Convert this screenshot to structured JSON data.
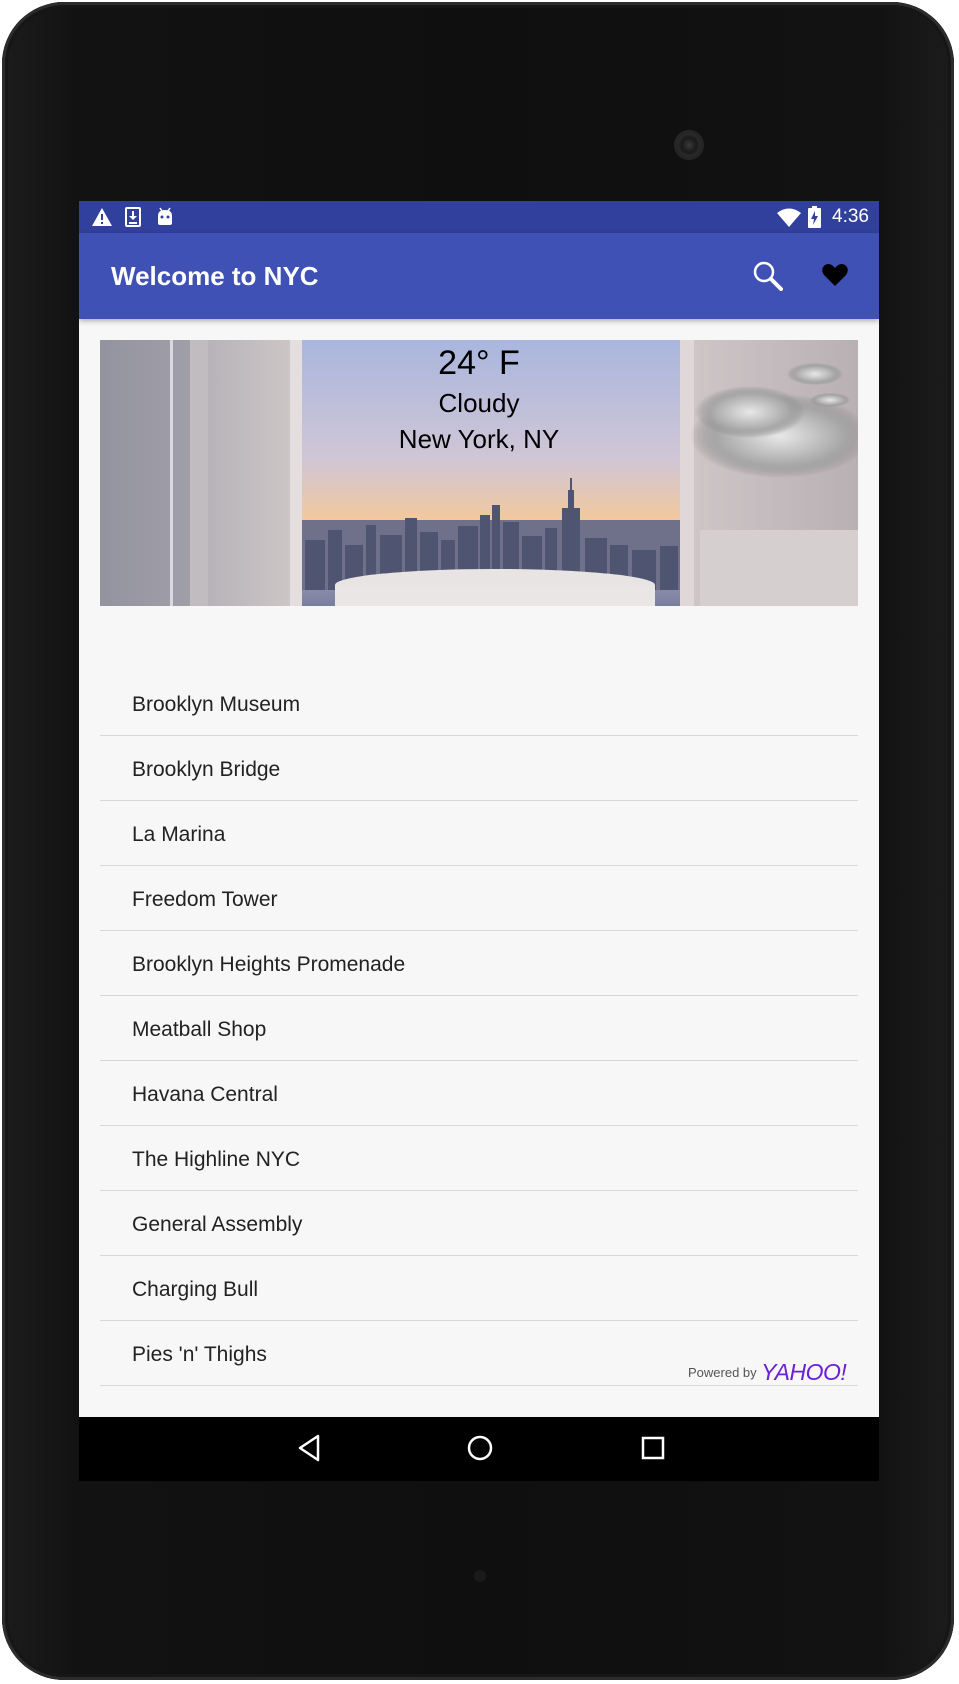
{
  "status_bar": {
    "time": "4:36",
    "left_icons": [
      "warning-icon",
      "download-icon",
      "android-debug-icon"
    ],
    "right_icons": [
      "wifi-icon",
      "battery-charging-icon"
    ]
  },
  "app_bar": {
    "title": "Welcome to NYC",
    "actions": [
      "search-icon",
      "heart-icon"
    ],
    "color": "#3f51b5",
    "status_color": "#32409d"
  },
  "weather": {
    "temperature": "24° F",
    "condition": "Cloudy",
    "location": "New York, NY",
    "condition_icon": "cloud-icon"
  },
  "places": [
    "Brooklyn Museum",
    "Brooklyn Bridge",
    "La Marina",
    "Freedom Tower",
    "Brooklyn Heights Promenade",
    "Meatball Shop",
    "Havana Central",
    "The Highline NYC",
    "General Assembly",
    "Charging Bull",
    "Pies 'n' Thighs"
  ],
  "attribution": {
    "label": "Powered by",
    "brand": "YAHOO!",
    "brand_color": "#6b21d6"
  },
  "nav_bar": {
    "buttons": [
      "back-icon",
      "home-icon",
      "recents-icon"
    ]
  }
}
